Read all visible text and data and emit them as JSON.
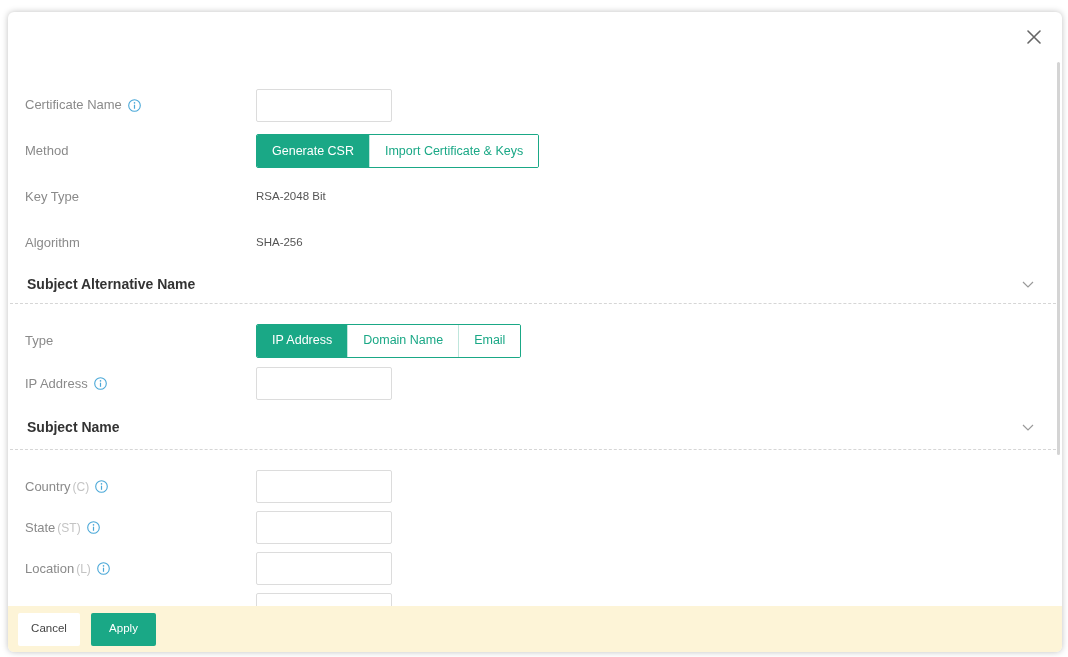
{
  "fields": [
    {
      "kind": "input",
      "label": "Certificate Name",
      "info": true
    },
    {
      "kind": "segmented",
      "label": "Method",
      "options": [
        {
          "label": "Generate CSR",
          "selected": true
        },
        {
          "label": "Import Certificate & Keys",
          "selected": false
        }
      ]
    },
    {
      "kind": "text",
      "label": "Key Type",
      "value": "RSA-2048 Bit"
    },
    {
      "kind": "text",
      "label": "Algorithm",
      "value": "SHA-256"
    }
  ],
  "sections": [
    {
      "title": "Subject Alternative Name",
      "expanded": true,
      "fields": [
        {
          "kind": "segmented",
          "label": "Type",
          "options": [
            {
              "label": "IP Address",
              "selected": true
            },
            {
              "label": "Domain Name",
              "selected": false
            },
            {
              "label": "Email",
              "selected": false
            }
          ]
        },
        {
          "kind": "input",
          "label": "IP Address",
          "info": true
        }
      ]
    },
    {
      "title": "Subject Name",
      "expanded": true,
      "fields": [
        {
          "kind": "input",
          "label": "Country",
          "code": "(C)",
          "info": true
        },
        {
          "kind": "input",
          "label": "State",
          "code": "(ST)",
          "info": true
        },
        {
          "kind": "input",
          "label": "Location",
          "code": "(L)",
          "info": true
        },
        {
          "kind": "input"
        }
      ]
    }
  ],
  "footer": {
    "buttons": [
      {
        "label": "Cancel",
        "kind": "secondary"
      },
      {
        "label": "Apply",
        "kind": "primary"
      }
    ]
  }
}
